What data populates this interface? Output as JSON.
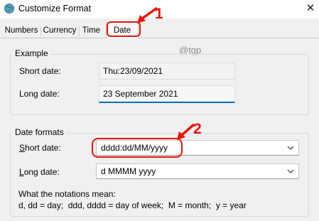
{
  "window": {
    "title": "Customize Format",
    "close_glyph": "✕"
  },
  "tabs": [
    {
      "label": "Numbers"
    },
    {
      "label": "Currency"
    },
    {
      "label": "Time"
    },
    {
      "label": "Date",
      "selected": true
    }
  ],
  "watermark": "@tgp",
  "callouts": {
    "one": "1",
    "two": "2",
    "color": "#e8150b"
  },
  "example": {
    "title": "Example",
    "short_label": "Short date:",
    "short_value": "Thu:23/09/2021",
    "long_label": "Long date:",
    "long_value": "23 September 2021"
  },
  "date_formats": {
    "title": "Date formats",
    "short_label_mnemonic": "S",
    "short_label_rest": "hort date:",
    "short_value": "dddd:dd/MM/yyyy",
    "long_label_mnemonic": "L",
    "long_label_rest": "ong date:",
    "long_value": "d MMMM yyyy",
    "notation_title": "What the notations mean:",
    "notation_text": "d, dd = day;  ddd, dddd = day of week;  M = month;  y = year"
  },
  "colors": {
    "accent": "#0f6cbd",
    "highlight": "#e8150b"
  }
}
